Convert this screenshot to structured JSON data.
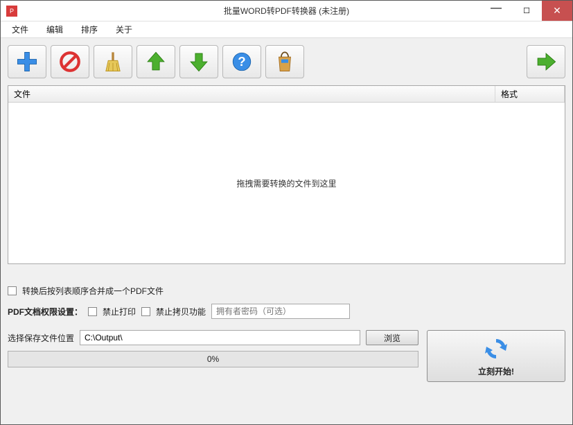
{
  "window": {
    "title": "批量WORD转PDF转换器 (未注册)"
  },
  "menu": {
    "file": "文件",
    "edit": "编辑",
    "sort": "排序",
    "about": "关于"
  },
  "list": {
    "col_file": "文件",
    "col_format": "格式",
    "placeholder": "拖拽需要转换的文件到这里"
  },
  "options": {
    "merge_label": "转换后按列表顺序合并成一个PDF文件",
    "perm_label": "PDF文档权限设置：",
    "disable_print": "禁止打印",
    "disable_copy": "禁止拷贝功能",
    "owner_pw_placeholder": "拥有者密码（可选）"
  },
  "output": {
    "label": "选择保存文件位置",
    "path": "C:\\Output\\",
    "browse": "浏览"
  },
  "progress": {
    "text": "0%"
  },
  "start": {
    "label": "立刻开始!"
  }
}
